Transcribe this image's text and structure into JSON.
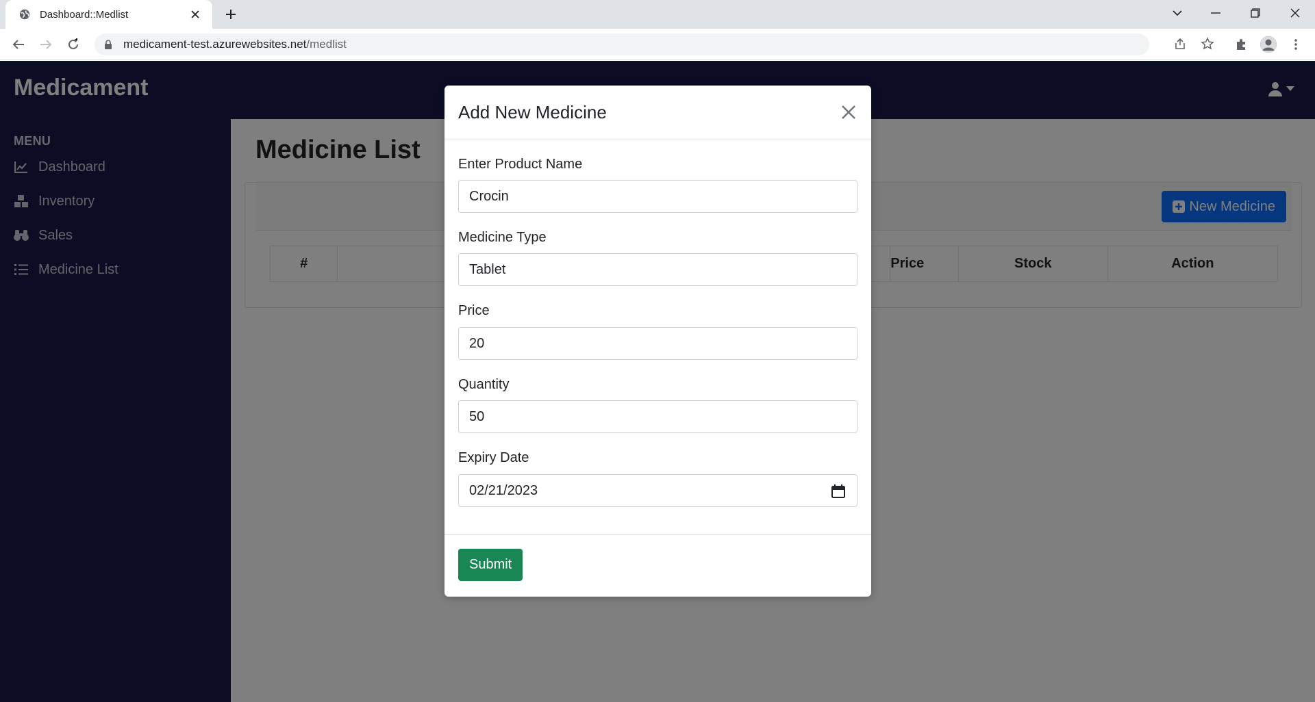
{
  "browser": {
    "tab_title": "Dashboard::Medlist",
    "url_host": "medicament-test.azurewebsites.net",
    "url_path": "/medlist"
  },
  "app": {
    "brand": "Medicament",
    "menu_heading": "MENU",
    "nav": [
      {
        "label": "Dashboard",
        "icon": "chart-line-icon"
      },
      {
        "label": "Inventory",
        "icon": "boxes-icon"
      },
      {
        "label": "Sales",
        "icon": "binoculars-icon"
      },
      {
        "label": "Medicine List",
        "icon": "list-icon"
      }
    ],
    "page_title": "Medicine List",
    "new_button": "New Medicine",
    "table_headers": [
      "#",
      "",
      "Price",
      "Stock",
      "Action"
    ]
  },
  "modal": {
    "title": "Add New Medicine",
    "fields": [
      {
        "label": "Enter Product Name",
        "value": "Crocin"
      },
      {
        "label": "Medicine Type",
        "value": "Tablet"
      },
      {
        "label": "Price",
        "value": "20"
      },
      {
        "label": "Quantity",
        "value": "50"
      },
      {
        "label": "Expiry Date",
        "value": "02/21/2023"
      }
    ],
    "submit_label": "Submit"
  },
  "colors": {
    "navbar": "#19194a",
    "primary": "#0d6efd",
    "success": "#198754"
  }
}
